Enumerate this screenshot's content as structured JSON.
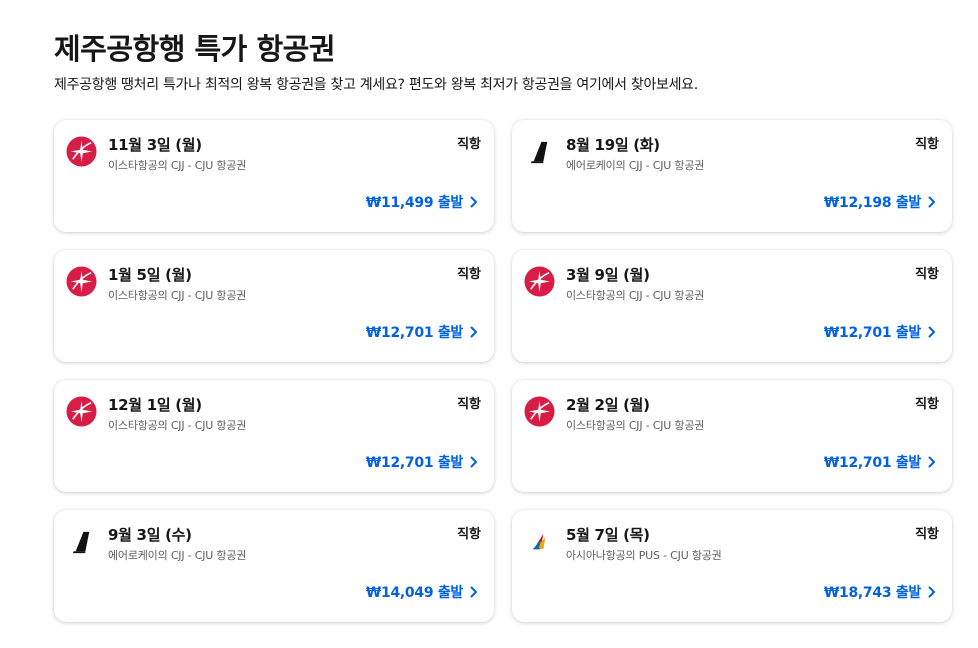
{
  "page": {
    "title": "제주공항행 특가 항공권",
    "subtitle": "제주공항행 땡처리 특가나 최적의 왕복 항공권을 찾고 계세요? 편도와 왕복 최저가 항공권을 여기에서 찾아보세요."
  },
  "deals": [
    {
      "date": "11월 3일 (월)",
      "route": "이스타항공의 CJJ - CJU 항공권",
      "stops": "직항",
      "price": "₩11,499 출발",
      "airline_icon": "eastar-jet-icon"
    },
    {
      "date": "8월 19일 (화)",
      "route": "에어로케이의 CJJ - CJU 항공권",
      "stops": "직항",
      "price": "₩12,198 출발",
      "airline_icon": "aero-k-icon"
    },
    {
      "date": "1월 5일 (월)",
      "route": "이스타항공의 CJJ - CJU 항공권",
      "stops": "직항",
      "price": "₩12,701 출발",
      "airline_icon": "eastar-jet-icon"
    },
    {
      "date": "3월 9일 (월)",
      "route": "이스타항공의 CJJ - CJU 항공권",
      "stops": "직항",
      "price": "₩12,701 출발",
      "airline_icon": "eastar-jet-icon"
    },
    {
      "date": "12월 1일 (월)",
      "route": "이스타항공의 CJJ - CJU 항공권",
      "stops": "직항",
      "price": "₩12,701 출발",
      "airline_icon": "eastar-jet-icon"
    },
    {
      "date": "2월 2일 (월)",
      "route": "이스타항공의 CJJ - CJU 항공권",
      "stops": "직항",
      "price": "₩12,701 출발",
      "airline_icon": "eastar-jet-icon"
    },
    {
      "date": "9월 3일 (수)",
      "route": "에어로케이의 CJJ - CJU 항공권",
      "stops": "직항",
      "price": "₩14,049 출발",
      "airline_icon": "aero-k-icon"
    },
    {
      "date": "5월 7일 (목)",
      "route": "아시아나항공의 PUS - CJU 항공권",
      "stops": "직항",
      "price": "₩18,743 출발",
      "airline_icon": "asiana-airlines-icon"
    }
  ],
  "colors": {
    "accent": "#0062e3",
    "eastar": "#d71d46",
    "text": "#161616",
    "muted": "#5e5e5e"
  }
}
